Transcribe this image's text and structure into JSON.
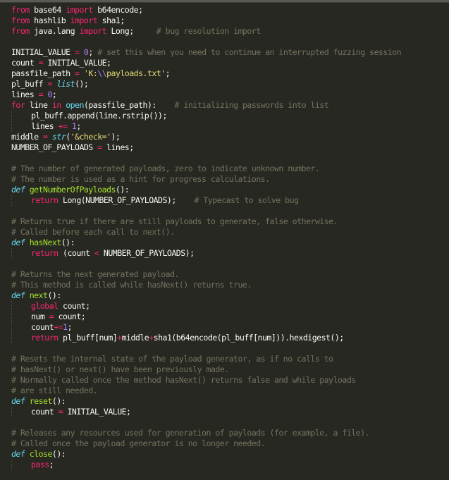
{
  "editor": {
    "theme": "monokai",
    "colors": {
      "background": "#272822",
      "keyword": "#f92672",
      "comment": "#75715e",
      "number": "#ae81ff",
      "string": "#e6db74",
      "function": "#a6e22e",
      "builtin": "#66d9ef",
      "text": "#f8f8f2"
    },
    "lines": [
      {
        "indent": 0,
        "tokens": [
          [
            "kw",
            "from"
          ],
          [
            "t",
            " base64 "
          ],
          [
            "kw",
            "import"
          ],
          [
            "t",
            " b64encode;"
          ]
        ]
      },
      {
        "indent": 0,
        "tokens": [
          [
            "kw",
            "from"
          ],
          [
            "t",
            " hashlib "
          ],
          [
            "kw",
            "import"
          ],
          [
            "t",
            " sha1;"
          ]
        ]
      },
      {
        "indent": 0,
        "tokens": [
          [
            "kw",
            "from"
          ],
          [
            "t",
            " java.lang "
          ],
          [
            "kw",
            "import"
          ],
          [
            "t",
            " Long;     "
          ],
          [
            "cm",
            "# bug resolution import"
          ]
        ]
      },
      {
        "indent": 0,
        "tokens": []
      },
      {
        "indent": 0,
        "tokens": [
          [
            "t",
            "INITIAL_VALUE "
          ],
          [
            "op",
            "="
          ],
          [
            "t",
            " "
          ],
          [
            "num",
            "0"
          ],
          [
            "t",
            "; "
          ],
          [
            "cm",
            "# set this when you need to continue an interrupted fuzzing session"
          ]
        ]
      },
      {
        "indent": 0,
        "tokens": [
          [
            "t",
            "count "
          ],
          [
            "op",
            "="
          ],
          [
            "t",
            " INITIAL_VALUE;"
          ]
        ]
      },
      {
        "indent": 0,
        "tokens": [
          [
            "t",
            "passfile_path "
          ],
          [
            "op",
            "="
          ],
          [
            "t",
            " "
          ],
          [
            "str",
            "'K:"
          ],
          [
            "esc",
            "\\\\"
          ],
          [
            "str",
            "payloads.txt'"
          ],
          [
            "t",
            ";"
          ]
        ]
      },
      {
        "indent": 0,
        "tokens": [
          [
            "t",
            "pl_buff "
          ],
          [
            "op",
            "="
          ],
          [
            "t",
            " "
          ],
          [
            "bi-i",
            "list"
          ],
          [
            "t",
            "();"
          ]
        ]
      },
      {
        "indent": 0,
        "tokens": [
          [
            "t",
            "lines "
          ],
          [
            "op",
            "="
          ],
          [
            "t",
            " "
          ],
          [
            "num",
            "0"
          ],
          [
            "t",
            ";"
          ]
        ]
      },
      {
        "indent": 0,
        "tokens": [
          [
            "kw",
            "for"
          ],
          [
            "t",
            " line "
          ],
          [
            "kw",
            "in"
          ],
          [
            "t",
            " "
          ],
          [
            "bi",
            "open"
          ],
          [
            "t",
            "(passfile_path):    "
          ],
          [
            "cm",
            "# initializing passwords into list"
          ]
        ]
      },
      {
        "indent": 1,
        "tokens": [
          [
            "t",
            "pl_buff.append(line.rstrip());"
          ]
        ]
      },
      {
        "indent": 1,
        "tokens": [
          [
            "t",
            "lines "
          ],
          [
            "op",
            "+="
          ],
          [
            "t",
            " "
          ],
          [
            "num",
            "1"
          ],
          [
            "t",
            ";"
          ]
        ]
      },
      {
        "indent": 0,
        "tokens": [
          [
            "t",
            "middle "
          ],
          [
            "op",
            "="
          ],
          [
            "t",
            " "
          ],
          [
            "bi-i",
            "str"
          ],
          [
            "t",
            "("
          ],
          [
            "str",
            "'&check='"
          ],
          [
            "t",
            ");"
          ]
        ]
      },
      {
        "indent": 0,
        "tokens": [
          [
            "t",
            "NUMBER_OF_PAYLOADS "
          ],
          [
            "op",
            "="
          ],
          [
            "t",
            " lines;"
          ]
        ]
      },
      {
        "indent": 0,
        "tokens": []
      },
      {
        "indent": 0,
        "tokens": [
          [
            "cm",
            "# The number of generated payloads, zero to indicate unknown number."
          ]
        ]
      },
      {
        "indent": 0,
        "tokens": [
          [
            "cm",
            "# The number is used as a hint for progress calculations."
          ]
        ]
      },
      {
        "indent": 0,
        "tokens": [
          [
            "def",
            "def"
          ],
          [
            "t",
            " "
          ],
          [
            "fn",
            "getNumberOfPayloads"
          ],
          [
            "t",
            "():"
          ]
        ]
      },
      {
        "indent": 1,
        "tokens": [
          [
            "kw",
            "return"
          ],
          [
            "t",
            " Long(NUMBER_OF_PAYLOADS);    "
          ],
          [
            "cm",
            "# Typecast to solve bug"
          ]
        ]
      },
      {
        "indent": 0,
        "tokens": []
      },
      {
        "indent": 0,
        "tokens": [
          [
            "cm",
            "# Returns true if there are still payloads to generate, false otherwise."
          ]
        ]
      },
      {
        "indent": 0,
        "tokens": [
          [
            "cm",
            "# Called before each call to next()."
          ]
        ]
      },
      {
        "indent": 0,
        "tokens": [
          [
            "def",
            "def"
          ],
          [
            "t",
            " "
          ],
          [
            "fn",
            "hasNext"
          ],
          [
            "t",
            "():"
          ]
        ]
      },
      {
        "indent": 1,
        "tokens": [
          [
            "kw",
            "return"
          ],
          [
            "t",
            " (count "
          ],
          [
            "op",
            "<"
          ],
          [
            "t",
            " NUMBER_OF_PAYLOADS);"
          ]
        ]
      },
      {
        "indent": 0,
        "tokens": []
      },
      {
        "indent": 0,
        "tokens": [
          [
            "cm",
            "# Returns the next generated payload."
          ]
        ]
      },
      {
        "indent": 0,
        "tokens": [
          [
            "cm",
            "# This method is called while hasNext() returns true."
          ]
        ]
      },
      {
        "indent": 0,
        "tokens": [
          [
            "def",
            "def"
          ],
          [
            "t",
            " "
          ],
          [
            "fn",
            "next"
          ],
          [
            "t",
            "():"
          ]
        ]
      },
      {
        "indent": 1,
        "tokens": [
          [
            "kw",
            "global"
          ],
          [
            "t",
            " count;"
          ]
        ]
      },
      {
        "indent": 1,
        "tokens": [
          [
            "t",
            "num "
          ],
          [
            "op",
            "="
          ],
          [
            "t",
            " count;"
          ]
        ]
      },
      {
        "indent": 1,
        "tokens": [
          [
            "t",
            "count"
          ],
          [
            "op",
            "+="
          ],
          [
            "num",
            "1"
          ],
          [
            "t",
            ";"
          ]
        ]
      },
      {
        "indent": 1,
        "tokens": [
          [
            "kw",
            "return"
          ],
          [
            "t",
            " pl_buff[num]"
          ],
          [
            "op",
            "+"
          ],
          [
            "t",
            "middle"
          ],
          [
            "op",
            "+"
          ],
          [
            "t",
            "sha1(b64encode(pl_buff[num])).hexdigest();"
          ]
        ]
      },
      {
        "indent": 0,
        "tokens": []
      },
      {
        "indent": 0,
        "tokens": [
          [
            "cm",
            "# Resets the internal state of the payload generator, as if no calls to"
          ]
        ]
      },
      {
        "indent": 0,
        "tokens": [
          [
            "cm",
            "# hasNext() or next() have been previously made."
          ]
        ]
      },
      {
        "indent": 0,
        "tokens": [
          [
            "cm",
            "# Normally called once the method hasNext() returns false and while payloads"
          ]
        ]
      },
      {
        "indent": 0,
        "tokens": [
          [
            "cm",
            "# are still needed."
          ]
        ]
      },
      {
        "indent": 0,
        "tokens": [
          [
            "def",
            "def"
          ],
          [
            "t",
            " "
          ],
          [
            "fn",
            "reset"
          ],
          [
            "t",
            "():"
          ]
        ]
      },
      {
        "indent": 1,
        "tokens": [
          [
            "t",
            "count "
          ],
          [
            "op",
            "="
          ],
          [
            "t",
            " INITIAL_VALUE;"
          ]
        ]
      },
      {
        "indent": 0,
        "tokens": []
      },
      {
        "indent": 0,
        "tokens": [
          [
            "cm",
            "# Releases any resources used for generation of payloads (for example, a file)."
          ]
        ]
      },
      {
        "indent": 0,
        "tokens": [
          [
            "cm",
            "# Called once the payload generator is no longer needed."
          ]
        ]
      },
      {
        "indent": 0,
        "tokens": [
          [
            "def",
            "def"
          ],
          [
            "t",
            " "
          ],
          [
            "fn",
            "close"
          ],
          [
            "t",
            "():"
          ]
        ]
      },
      {
        "indent": 1,
        "tokens": [
          [
            "kw",
            "pass"
          ],
          [
            "t",
            ";"
          ]
        ]
      }
    ]
  }
}
